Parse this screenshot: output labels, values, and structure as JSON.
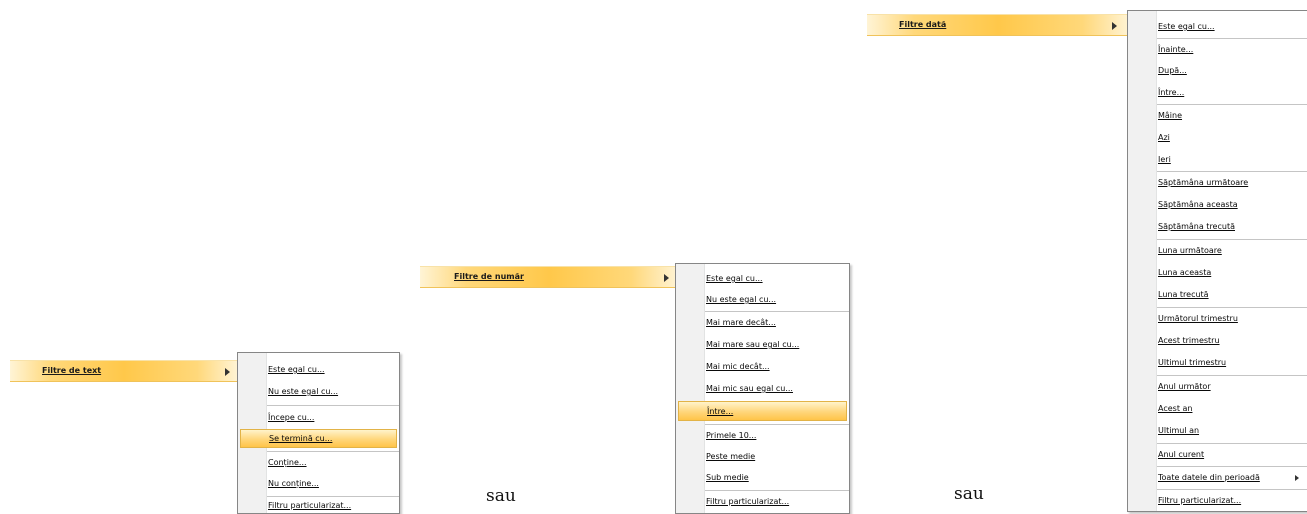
{
  "text_filters": {
    "parent_label": "Filtre de text",
    "items": [
      "Este egal cu...",
      "Nu este egal cu...",
      "Începe cu...",
      "Se termină cu...",
      "Conține...",
      "Nu conține...",
      "Filtru particularizat..."
    ],
    "highlighted_index": 3
  },
  "number_filters": {
    "parent_label": "Filtre de număr",
    "items": [
      "Este egal cu...",
      "Nu este egal cu...",
      "Mai mare decât...",
      "Mai mare sau egal cu...",
      "Mai mic decât...",
      "Mai mic sau egal cu...",
      "Între...",
      "Primele 10...",
      "Peste medie",
      "Sub medie",
      "Filtru particularizat..."
    ],
    "highlighted_index": 6
  },
  "date_filters": {
    "parent_label": "Filtre dată",
    "items": [
      "Este egal cu...",
      "Înainte...",
      "După...",
      "Între...",
      "Mâine",
      "Azi",
      "Ieri",
      "Săptămâna următoare",
      "Săptămâna aceasta",
      "Săptămâna trecută",
      "Luna următoare",
      "Luna aceasta",
      "Luna trecută",
      "Următorul trimestru",
      "Acest trimestru",
      "Ultimul trimestru",
      "Anul următor",
      "Acest an",
      "Ultimul an",
      "Anul curent",
      "Toate datele din perioadă",
      "Filtru particularizat..."
    ]
  },
  "separator_words": [
    "sau",
    "sau"
  ],
  "colors": {
    "highlight": "#ffd67b",
    "menu_border": "#868686",
    "gutter": "#f1f1f1"
  }
}
